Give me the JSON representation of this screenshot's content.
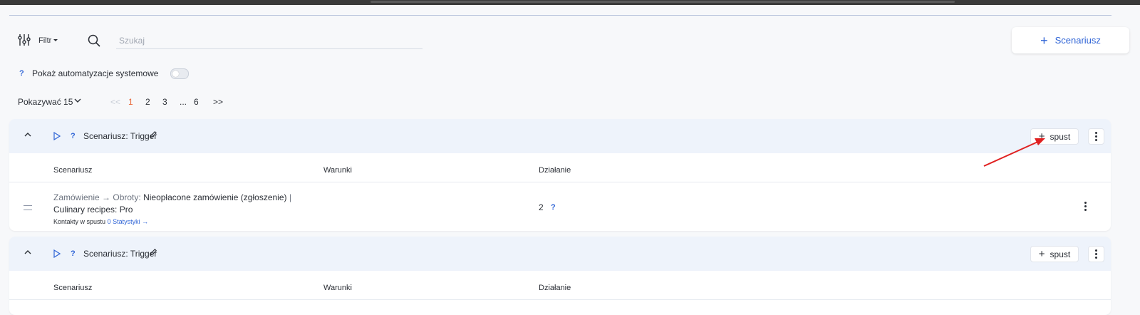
{
  "filter": {
    "label": "Filtr",
    "search_placeholder": "Szukaj"
  },
  "actions": {
    "add_scenario_label": "Scenariusz"
  },
  "system_automations": {
    "help": "?",
    "label": "Pokaż automatyzacje systemowe",
    "enabled": false
  },
  "pagination": {
    "per_page_label": "Pokazywać 15",
    "first": "<<",
    "pages": [
      "1",
      "2",
      "3",
      "...",
      "6"
    ],
    "current": "1",
    "next": ">>"
  },
  "scenarios": [
    {
      "help": "?",
      "title": "Scenariusz: Trigger",
      "add_trigger_label": "spust",
      "columns": [
        "Scenariusz",
        "Warunki",
        "Działanie"
      ],
      "rows": [
        {
          "path_muted": "Zamówienie → Obroty:",
          "path_main": "Nieopłacone zamówienie (zgłoszenie)",
          "separator": "|",
          "path_tail": "Culinary recipes: Pro",
          "contacts_label": "Kontakty w spustu",
          "contacts_count": "0",
          "stats_link": "Statystyki →",
          "actions_count": "2",
          "actions_help": "?"
        }
      ]
    },
    {
      "help": "?",
      "title": "Scenariusz: Trigger",
      "add_trigger_label": "spust",
      "columns": [
        "Scenariusz",
        "Warunki",
        "Działanie"
      ]
    }
  ],
  "colors": {
    "accent": "#2f64d6",
    "active_page": "#e8683a",
    "annotation_arrow": "#e02020"
  }
}
